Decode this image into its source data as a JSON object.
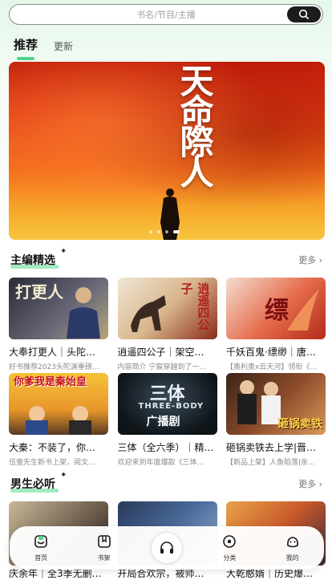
{
  "search": {
    "placeholder": "书名/节目/主播"
  },
  "tabs": [
    {
      "label": "推荐",
      "active": true
    },
    {
      "label": "更新",
      "active": false
    }
  ],
  "banner": {
    "title": "天命際人",
    "slides": 4,
    "active_slide": 3
  },
  "section1": {
    "title": "主编精选",
    "more": "更多",
    "items": [
      {
        "title": "大奉打更人｜头陀…",
        "desc": "好书推荐2023头陀渊重磅…",
        "cover_text": "打更人"
      },
      {
        "title": "逍遥四公子｜架空…",
        "desc": "内容简介 宁宸穿越到了一…",
        "cover_text": "逍遥四公子"
      },
      {
        "title": "千妖百鬼·缥缈｜唐…",
        "desc": "【奥利奥x云天河】领衔《…",
        "cover_text": "缥"
      },
      {
        "title": "大秦：不装了，你…",
        "desc": "伍壹先生新书上架，阅文…",
        "cover_text": "你爹我是秦始皇"
      },
      {
        "title": "三体（全六季）｜精…",
        "desc": "欢迎来到年度爆款《三体…",
        "cover_text": "三体",
        "cover_sub": "THREE-BODY",
        "cover_sub2": "广播剧"
      },
      {
        "title": "砸锅卖铁去上学|晋…",
        "desc": "【新品上架】人鱼陷落|余…",
        "cover_text": "砸锅卖铁"
      }
    ]
  },
  "section2": {
    "title": "男生必听",
    "more": "更多",
    "items": [
      {
        "title": "庆余年｜全3季无删…"
      },
      {
        "title": "开局合欢宗，被师…"
      },
      {
        "title": "大乾憨婿｜历史爆…"
      }
    ]
  },
  "nav": [
    {
      "label": "首页",
      "icon": "home-icon",
      "active": true
    },
    {
      "label": "书架",
      "icon": "bookshelf-icon"
    },
    {
      "label": "",
      "icon": "headphones-icon"
    },
    {
      "label": "分类",
      "icon": "category-icon"
    },
    {
      "label": "我的",
      "icon": "profile-icon"
    }
  ],
  "colors": {
    "accent": "#4fd38a",
    "search_button": "#1c1c1c"
  }
}
